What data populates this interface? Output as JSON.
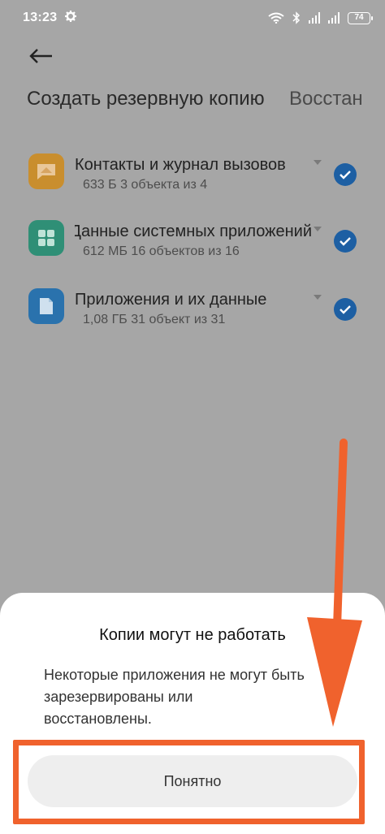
{
  "status_bar": {
    "time": "13:23",
    "battery": "74"
  },
  "tabs": [
    {
      "label": "Создать резервную копию"
    },
    {
      "label": "Восстан"
    }
  ],
  "items": [
    {
      "title": "Контакты и журнал вызовов",
      "subtitle": "633 Б  3 объекта из 4",
      "icon": "contacts-icon",
      "icon_color": "#c98e2e",
      "checked": true
    },
    {
      "title": "Данные системных приложений",
      "subtitle": "612 МБ  16 объектов из 16",
      "icon": "system-apps-icon",
      "icon_color": "#2f8f76",
      "checked": true
    },
    {
      "title": "Приложения и их данные",
      "subtitle": "1,08 ГБ  31 объект из 31",
      "icon": "app-file-icon",
      "icon_color": "#2a72ad",
      "checked": true
    }
  ],
  "dialog": {
    "title": "Копии могут не работать",
    "message_lines": [
      "Некоторые приложения не могут быть",
      "зарезервированы или",
      "восстановлены."
    ],
    "ok_label": "Понятно"
  },
  "colors": {
    "annotation": "#f0622d",
    "check": "#1d5fa3",
    "overlay": "#a6a6a6"
  }
}
